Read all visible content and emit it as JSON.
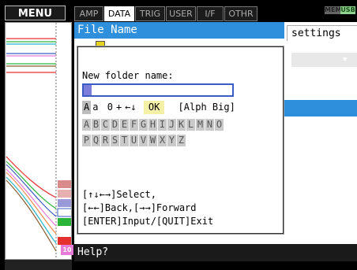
{
  "menu": {
    "label": "MENU"
  },
  "tabs": [
    {
      "label": "AMP",
      "active": false
    },
    {
      "label": "DATA",
      "active": true
    },
    {
      "label": "TRIG",
      "active": false
    },
    {
      "label": "USER",
      "active": false
    },
    {
      "label": "I/F",
      "active": false
    },
    {
      "label": "OTHR",
      "active": false
    }
  ],
  "badges": {
    "mem": "MEM",
    "usb": "USB"
  },
  "header": {
    "title": "File Name",
    "settings": "settings"
  },
  "dialog": {
    "prompt": "New folder name:",
    "input_value": "",
    "modes": {
      "upper": "A",
      "lower": "a",
      "digits": "0",
      "symbol": "+",
      "arrows": "←↓",
      "ok": "OK",
      "status": "[Alph Big]"
    },
    "charset_row1": [
      "A",
      "B",
      "C",
      "D",
      "E",
      "F",
      "G",
      "H",
      "I",
      "J",
      "K",
      "L",
      "M",
      "N",
      "O"
    ],
    "charset_row2": [
      "P",
      "Q",
      "R",
      "S",
      "T",
      "U",
      "V",
      "W",
      "X",
      "Y",
      "Z"
    ],
    "help_line1": "[↑↓←→]Select,",
    "help_line2": "[←←]Back,[→→]Forward",
    "help_line3": "[ENTER]Input/[QUIT]Exit"
  },
  "status": {
    "text": "Help?"
  },
  "channel_marker": "10",
  "channel_colors": {
    "ch1": "#e63030",
    "ch2": "#2bb43a",
    "ch3": "#3b5cc4",
    "ch4": "#e6d21a",
    "ch5": "#e87ad8",
    "ch6": "#f08a4b",
    "ch7": "#22b5c9",
    "ch8": "#8a5a2b"
  }
}
